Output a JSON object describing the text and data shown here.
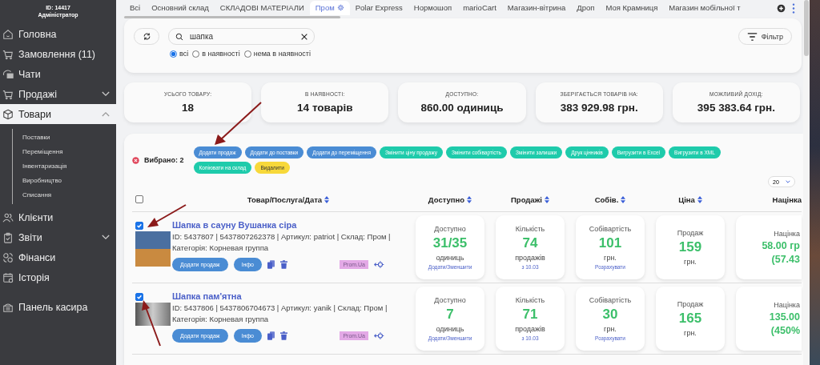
{
  "sidebar": {
    "account_id": "ID: 14417",
    "role": "Адміністратор",
    "items": [
      {
        "label": "Головна",
        "selected": false
      },
      {
        "label": "Замовлення (11)",
        "selected": false
      },
      {
        "label": "Чати",
        "selected": false
      },
      {
        "label": "Продажі",
        "selected": false,
        "expanded": false
      },
      {
        "label": "Товари",
        "selected": true,
        "expanded": true,
        "children": [
          {
            "label": "Поставки"
          },
          {
            "label": "Переміщення"
          },
          {
            "label": "Інвентаризація"
          },
          {
            "label": "Виробництво"
          },
          {
            "label": "Списання"
          }
        ]
      },
      {
        "label": "Клієнти",
        "selected": false
      },
      {
        "label": "Звіти",
        "selected": false,
        "expanded": false
      },
      {
        "label": "Фінанси",
        "selected": false
      },
      {
        "label": "Історія",
        "selected": false
      }
    ],
    "bottom_items": [
      {
        "label": "Панель касира",
        "selected": false
      }
    ]
  },
  "tabs": [
    {
      "label": "Всі",
      "selected": false
    },
    {
      "label": "Основний склад",
      "selected": false
    },
    {
      "label": "СКЛАДОВІ МАТЕРІАЛИ",
      "selected": false
    },
    {
      "label": "Пром",
      "selected": true
    },
    {
      "label": "Polar Express",
      "selected": false
    },
    {
      "label": "Нормошоп",
      "selected": false
    },
    {
      "label": "marioCart",
      "selected": false
    },
    {
      "label": "Магазин-вітрина",
      "selected": false
    },
    {
      "label": "Дроп",
      "selected": false
    },
    {
      "label": "Моя Крамниця",
      "selected": false
    },
    {
      "label": "Магазин мобільної т",
      "selected": false
    }
  ],
  "search": {
    "value": "шапка"
  },
  "stock_filter": [
    {
      "label": "всі",
      "selected": true
    },
    {
      "label": "в наявності",
      "selected": false
    },
    {
      "label": "нема в наявності",
      "selected": false
    }
  ],
  "filter_button": "Фільтр",
  "stats": [
    {
      "label": "УСЬОГО ТОВАРУ:",
      "value": "18"
    },
    {
      "label": "В НАЯВНОСТІ:",
      "value": "14 товарів"
    },
    {
      "label": "ДОСТУПНО:",
      "value": "860.00 одиниць"
    },
    {
      "label": "ЗБЕРІГАЄТЬСЯ ТОВАРІВ НА:",
      "value": "383 929.98 грн."
    },
    {
      "label": "МОЖЛИВИЙ ДОХІД:",
      "value": "395 383.64 грн."
    }
  ],
  "selection": {
    "label": "Вибрано: 2",
    "actions": [
      {
        "label": "Додати продаж",
        "color": "#4a8cd4"
      },
      {
        "label": "Додати до поставки",
        "color": "#4a8cd4"
      },
      {
        "label": "Додати до переміщення",
        "color": "#4a8cd4"
      },
      {
        "label": "Змінити ціну продажу",
        "color": "#1ecbab"
      },
      {
        "label": "Змінити собівартість",
        "color": "#1ecbab"
      },
      {
        "label": "Змінити залишки",
        "color": "#1ecbab"
      },
      {
        "label": "Друк цінників",
        "color": "#1ecbab"
      },
      {
        "label": "Вигрузити в Excel",
        "color": "#1ecbab"
      },
      {
        "label": "Вигрузити в XML",
        "color": "#1ecbab"
      },
      {
        "label": "Копіювати на склад",
        "color": "#1ecbab"
      },
      {
        "label": "Видалити",
        "color": "#f7d83a"
      }
    ]
  },
  "page_size": "20",
  "table": {
    "select_all": {
      "checked": false
    },
    "product_column": {
      "label": "Товар/Послуга/Дата",
      "sortable": true
    },
    "columns": [
      {
        "label": "Доступно",
        "sortable": true
      },
      {
        "label": "Продажі",
        "sortable": true
      },
      {
        "label": "Собів.",
        "sortable": true
      },
      {
        "label": "Ціна",
        "sortable": true
      },
      {
        "label": "Націнка",
        "sortable": false
      }
    ],
    "rows": [
      {
        "checked": true,
        "name": "Шапка в сауну Вушанка сіра",
        "meta": "ID: 5437807 | 5437807262378 | Артикул: patriot | Склад: Пром |",
        "category": "Категорія: Корневая группа",
        "buttons": [
          "Додати продаж",
          "Інфо"
        ],
        "tag": "Prom.Ua",
        "cells": [
          {
            "label": "Доступно",
            "value": "31/35",
            "unit": "одиниць",
            "link": "Додати/Зменшити"
          },
          {
            "label": "Кількість",
            "value": "74",
            "unit": "продажів",
            "link": "з 10.03"
          },
          {
            "label": "Собівартість",
            "value": "101",
            "unit": "грн.",
            "link": "Розрахувати"
          },
          {
            "label": "Продаж",
            "value": "159",
            "unit": "грн."
          },
          {
            "label": "Націнка",
            "value": "58.00 гр",
            "unit": "(57.43"
          }
        ]
      },
      {
        "checked": true,
        "name": "Шапка пам'ятна",
        "meta": "ID: 5437806 | 5437806704673 | Артикул: yanik | Склад: Пром |",
        "category": "Категорія: Корневая группа",
        "buttons": [
          "Додати продаж",
          "Інфо"
        ],
        "tag": "Prom.Ua",
        "cells": [
          {
            "label": "Доступно",
            "value": "7",
            "unit": "одиниць",
            "link": "Додати/Зменшити"
          },
          {
            "label": "Кількість",
            "value": "71",
            "unit": "продажів",
            "link": "з 10.03"
          },
          {
            "label": "Собівартість",
            "value": "30",
            "unit": "грн.",
            "link": "Розрахувати"
          },
          {
            "label": "Продаж",
            "value": "165",
            "unit": "грн."
          },
          {
            "label": "Націнка",
            "value": "135.00",
            "unit": "(450%"
          }
        ]
      }
    ]
  }
}
